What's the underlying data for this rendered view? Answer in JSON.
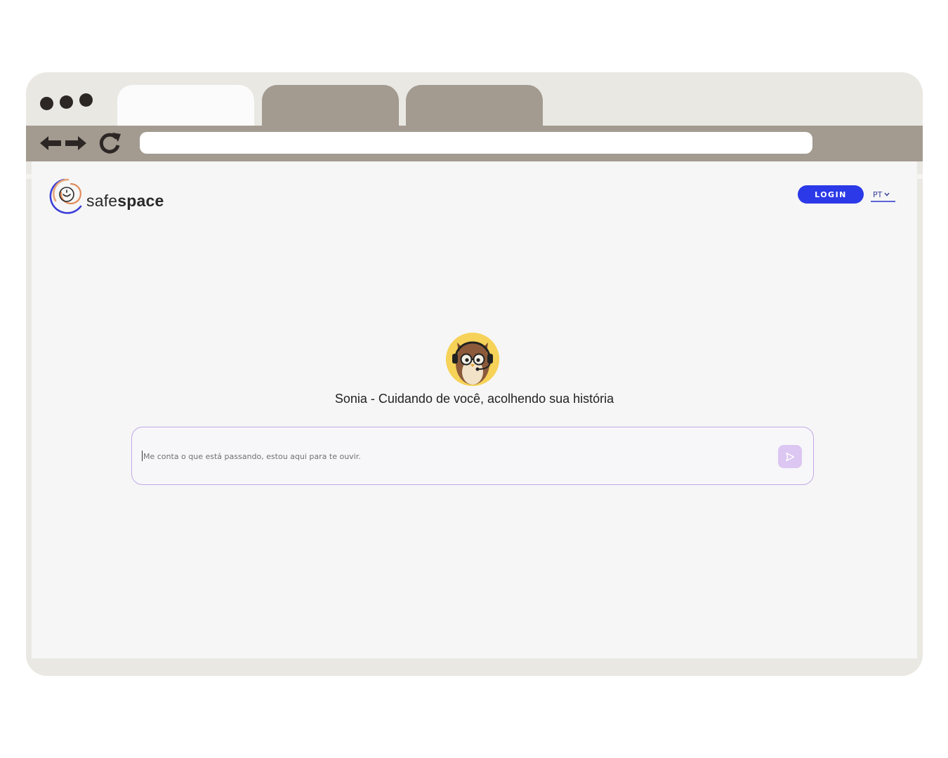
{
  "browser": {
    "address": "",
    "icons": {
      "back": "arrow-left-icon",
      "forward": "arrow-right-icon",
      "reload": "reload-icon"
    }
  },
  "app": {
    "logo_light": "safe",
    "logo_bold": "space",
    "login_label": "LOGIN",
    "language": "PT"
  },
  "assistant": {
    "title": "Sonia - Cuidando de você, acolhendo sua história"
  },
  "chat": {
    "placeholder": "Me conta o que está passando, estou aqui para te ouvir."
  },
  "colors": {
    "accent": "#2b39e8",
    "chat_border": "#c2a9e6",
    "send_button": "#dcc6f2",
    "avatar_bg": "#f6d258",
    "browser_chrome": "#a39a90"
  }
}
